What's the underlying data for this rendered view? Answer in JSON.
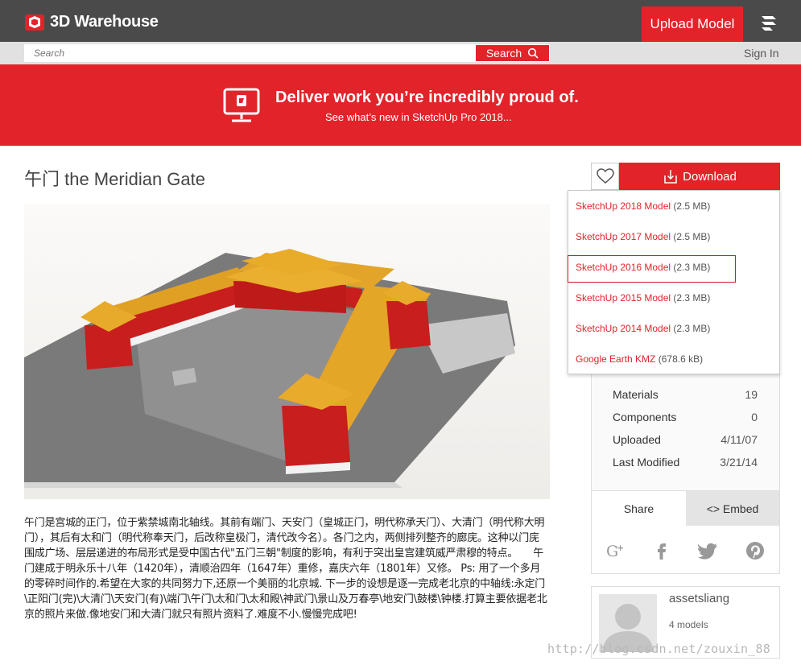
{
  "header": {
    "logo_text": "3D Warehouse",
    "upload_label": "Upload Model"
  },
  "search": {
    "placeholder": "Search",
    "button_label": "Search",
    "signin_label": "Sign In"
  },
  "banner": {
    "title": "Deliver work you’re incredibly proud of.",
    "subtitle": "See what’s new in SketchUp Pro 2018..."
  },
  "model": {
    "title": "午门 the Meridian Gate",
    "description": "午门是宫城的正门，位于紫禁城南北轴线。其前有端门、天安门（皇城正门，明代称承天门）、大清门（明代称大明门），其后有太和门（明代称奉天门，后改称皇极门，清代改今名）。各门之内，两侧排列整齐的廊庑。这种以门庑围成广场、层层递进的布局形式是受中国古代\"五门三朝\"制度的影响，有利于突出皇宫建筑威严肃穆的特点。　　午门建成于明永乐十八年（1420年），清顺治四年（1647年）重修，嘉庆六年（1801年）又修。 Ps: 用了一个多月的零碎时间作的.希望在大家的共同努力下,还原一个美丽的北京城. 下一步的设想是逐一完成老北京的中轴线:永定门\\正阳门(完)\\大清门\\天安门(有)\\端门\\午门\\太和门\\太和殿\\神武门\\景山及万春亭\\地安门\\鼓楼\\钟楼.打算主要依据老北京的照片来做.像地安门和大清门就只有照片资料了.难度不小.慢慢完成吧!"
  },
  "download": {
    "label": "Download",
    "options": [
      {
        "name": "SketchUp 2018 Model",
        "size": "(2.5 MB)"
      },
      {
        "name": "SketchUp 2017 Model",
        "size": "(2.5 MB)"
      },
      {
        "name": "SketchUp 2016 Model",
        "size": "(2.3 MB)"
      },
      {
        "name": "SketchUp 2015 Model",
        "size": "(2.3 MB)"
      },
      {
        "name": "SketchUp 2014 Model",
        "size": "(2.3 MB)"
      },
      {
        "name": "Google Earth KMZ",
        "size": "(678.6 kB)"
      }
    ]
  },
  "stats": [
    {
      "label": "Materials",
      "value": "19"
    },
    {
      "label": "Components",
      "value": "0"
    },
    {
      "label": "Uploaded",
      "value": "4/11/07"
    },
    {
      "label": "Last Modified",
      "value": "3/21/14"
    }
  ],
  "share": {
    "tab_share": "Share",
    "tab_embed": "<> Embed"
  },
  "author": {
    "name": "assetsliang",
    "models": "4 models"
  },
  "watermark": "http://blog.csdn.net/zouxin_88",
  "colors": {
    "brand_red": "#e2232a",
    "topbar": "#4a4a4a"
  }
}
